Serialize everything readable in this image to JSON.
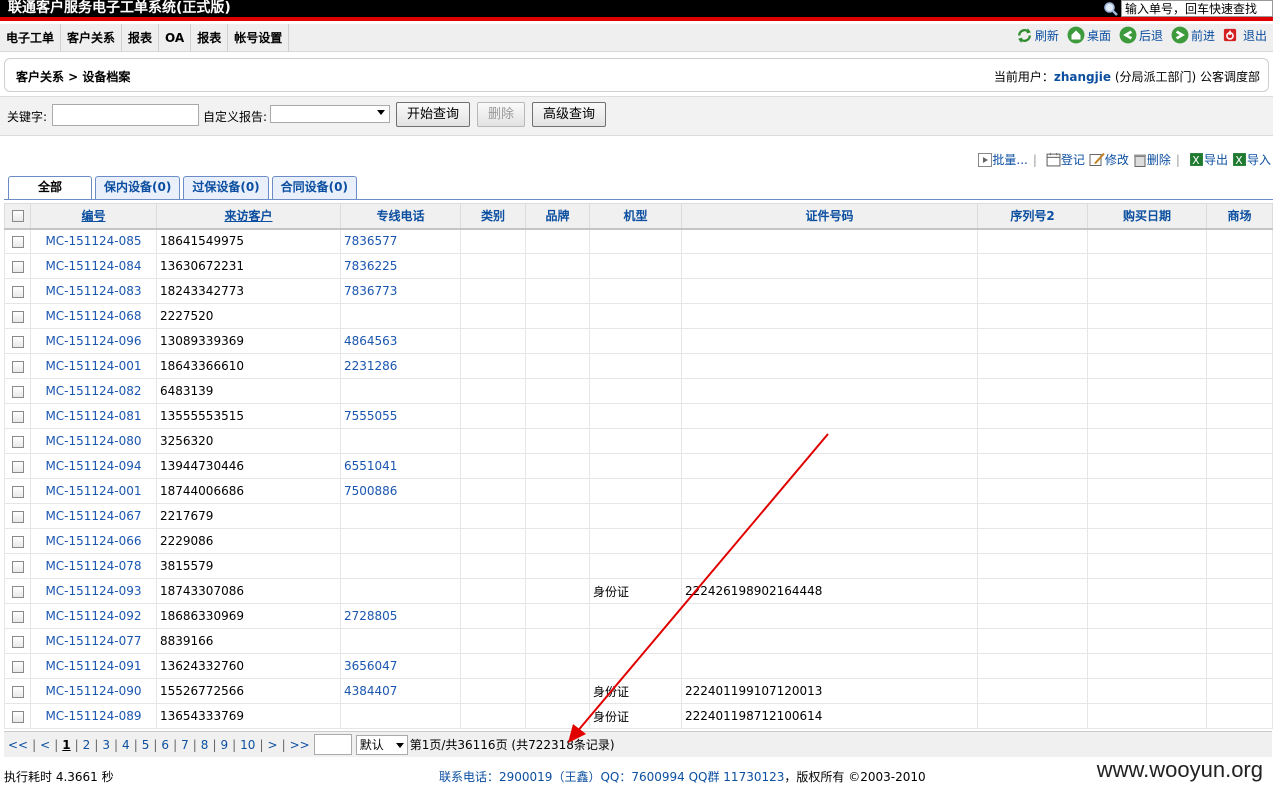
{
  "app": {
    "title": "联通客户服务电子工单系统(正式版)",
    "quick_search_value": "输入单号，回车快速查找"
  },
  "menu": [
    "电子工单",
    "客户关系",
    "报表",
    "OA",
    "报表",
    "帐号设置"
  ],
  "nav": {
    "refresh": "刷新",
    "desktop": "桌面",
    "back": "后退",
    "forward": "前进",
    "exit": "退出"
  },
  "breadcrumb": "客户关系 > 设备档案",
  "user": {
    "prefix": "当前用户：",
    "name": "zhangjie",
    "suffix": " (分局派工部门) 公客调度部"
  },
  "search": {
    "keyword_label": "关键字:",
    "report_label": "自定义报告:",
    "start_btn": "开始查询",
    "delete_btn": "删除",
    "advanced_btn": "高级查询"
  },
  "actions": {
    "batch": "批量...",
    "register": "登记",
    "edit": "修改",
    "delete": "删除",
    "export": "导出",
    "import": "导入"
  },
  "tabs": [
    "全部",
    "保内设备(0)",
    "过保设备(0)",
    "合同设备(0)"
  ],
  "columns": [
    "编号",
    "来访客户",
    "专线电话",
    "类别",
    "品牌",
    "机型",
    "证件号码",
    "序列号2",
    "购买日期",
    "商场"
  ],
  "rows": [
    {
      "code": "MC-151124-085",
      "customer": "18641549975",
      "phone": "7836577",
      "type": "",
      "id": ""
    },
    {
      "code": "MC-151124-084",
      "customer": "13630672231",
      "phone": "7836225",
      "type": "",
      "id": ""
    },
    {
      "code": "MC-151124-083",
      "customer": "18243342773",
      "phone": "7836773",
      "type": "",
      "id": ""
    },
    {
      "code": "MC-151124-068",
      "customer": "2227520",
      "phone": "",
      "type": "",
      "id": ""
    },
    {
      "code": "MC-151124-096",
      "customer": "13089339369",
      "phone": "4864563",
      "type": "",
      "id": ""
    },
    {
      "code": "MC-151124-001",
      "customer": "18643366610",
      "phone": "2231286",
      "type": "",
      "id": ""
    },
    {
      "code": "MC-151124-082",
      "customer": "6483139",
      "phone": "",
      "type": "",
      "id": ""
    },
    {
      "code": "MC-151124-081",
      "customer": "13555553515",
      "phone": "7555055",
      "type": "",
      "id": ""
    },
    {
      "code": "MC-151124-080",
      "customer": "3256320",
      "phone": "",
      "type": "",
      "id": ""
    },
    {
      "code": "MC-151124-094",
      "customer": "13944730446",
      "phone": "6551041",
      "type": "",
      "id": ""
    },
    {
      "code": "MC-151124-001",
      "customer": "18744006686",
      "phone": "7500886",
      "type": "",
      "id": ""
    },
    {
      "code": "MC-151124-067",
      "customer": "2217679",
      "phone": "",
      "type": "",
      "id": ""
    },
    {
      "code": "MC-151124-066",
      "customer": "2229086",
      "phone": "",
      "type": "",
      "id": ""
    },
    {
      "code": "MC-151124-078",
      "customer": "3815579",
      "phone": "",
      "type": "",
      "id": ""
    },
    {
      "code": "MC-151124-093",
      "customer": "18743307086",
      "phone": "",
      "type": "身份证",
      "id": "222426198902164448"
    },
    {
      "code": "MC-151124-092",
      "customer": "18686330969",
      "phone": "2728805",
      "type": "",
      "id": ""
    },
    {
      "code": "MC-151124-077",
      "customer": "8839166",
      "phone": "",
      "type": "",
      "id": ""
    },
    {
      "code": "MC-151124-091",
      "customer": "13624332760",
      "phone": "3656047",
      "type": "",
      "id": ""
    },
    {
      "code": "MC-151124-090",
      "customer": "15526772566",
      "phone": "4384407",
      "type": "身份证",
      "id": "222401199107120013"
    },
    {
      "code": "MC-151124-089",
      "customer": "13654333769",
      "phone": "",
      "type": "身份证",
      "id": "222401198712100614"
    }
  ],
  "pager": {
    "first": "<<",
    "prev": "<",
    "pages": [
      "1",
      "2",
      "3",
      "4",
      "5",
      "6",
      "7",
      "8",
      "9",
      "10"
    ],
    "next": ">",
    "last": ">>",
    "size": "默认",
    "info": "第1页/共36116页 (共722318条记录)"
  },
  "footer": {
    "exec_time": "执行耗时 4.3661 秒",
    "contact": "联系电话：2900019（王鑫）QQ：7600994 QQ群 11730123",
    "copyright": "，版权所有 ©2003-2010"
  },
  "watermark": "www.wooyun.org",
  "colors": {
    "link": "#1a56b0",
    "accent": "#e00000",
    "annotation_arrow": "#e00000"
  }
}
